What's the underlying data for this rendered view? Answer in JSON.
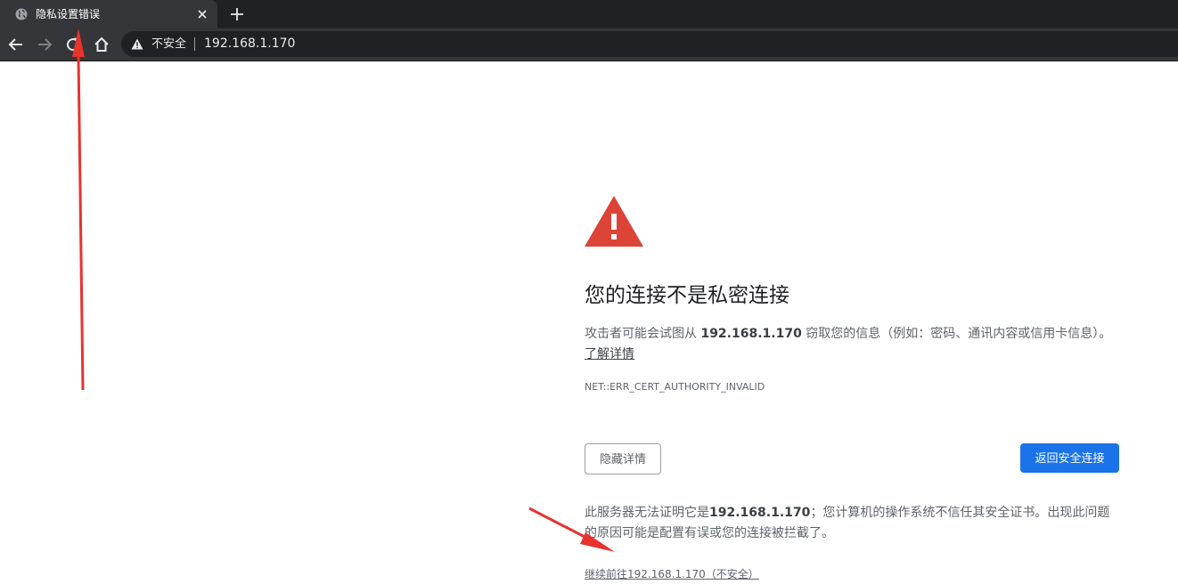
{
  "tab": {
    "title": "隐私设置错误",
    "favicon": "globe-icon",
    "close_icon": "close-icon"
  },
  "new_tab_icon": "plus-icon",
  "toolbar": {
    "back_icon": "arrow-left-icon",
    "forward_icon": "arrow-right-icon",
    "reload_icon": "reload-icon",
    "home_icon": "home-icon"
  },
  "omnibox": {
    "security_icon": "warning-triangle-icon",
    "security_label": "不安全",
    "url": "192.168.1.170"
  },
  "interstitial": {
    "warning_icon": "warning-triangle-icon",
    "heading": "您的连接不是私密连接",
    "desc_prefix": "攻击者可能会试图从 ",
    "desc_host": "192.168.1.170",
    "desc_suffix": " 窃取您的信息（例如：密码、通讯内容或信用卡信息）。",
    "learn_more": "了解详情",
    "error_code": "NET::ERR_CERT_AUTHORITY_INVALID",
    "hide_details_label": "隐藏详情",
    "back_to_safety_label": "返回安全连接",
    "details_prefix": "此服务器无法证明它是",
    "details_host": "192.168.1.170",
    "details_suffix": "；您计算机的操作系统不信任其安全证书。出现此问题的原因可能是配置有误或您的连接被拦截了。",
    "proceed_link": "继续前往192.168.1.170（不安全）"
  },
  "colors": {
    "tabstrip_bg": "#202124",
    "toolbar_bg": "#35363a",
    "warning_red": "#db4437",
    "primary_blue": "#1a73e8",
    "annotation_red": "#e8332f"
  }
}
